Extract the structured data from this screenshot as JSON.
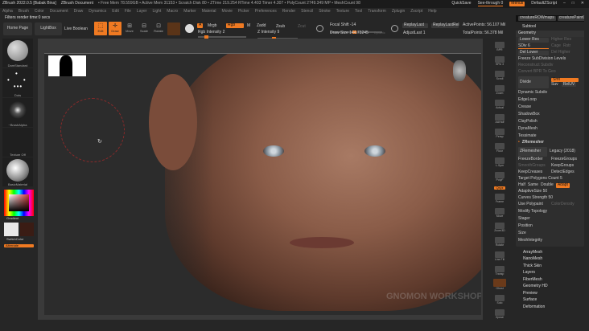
{
  "titlebar": {
    "app": "ZBrush 2022.0.5 [Babak Bina]",
    "doc": "ZBrush Document",
    "stats": "• Free Mem 78.559GB • Active Mem 31153 • Scratch Disk 80 • ZTime 219.254 RTime 4.403 Timer 4.307 • PolyCount 2749.349 MP • MeshCount 98",
    "quicksave": "QuickSave",
    "seethrough": "See-through 0",
    "menus": "Menus",
    "script": "DefaultZScript"
  },
  "menu": [
    "Alpha",
    "Brush",
    "Color",
    "Document",
    "Draw",
    "Dynamics",
    "Edit",
    "File",
    "Layer",
    "Light",
    "Macro",
    "Marker",
    "Material",
    "Movie",
    "Picker",
    "Preferences",
    "Render",
    "Stencil",
    "Stroke",
    "Texture",
    "Tool",
    "Transform",
    "Zplugin",
    "Zscript",
    "Help"
  ],
  "filters": "Filters render time:0 secs",
  "shelf": {
    "home": "Home Page",
    "lightbox": "LightBox",
    "live_boolean": "Live Boolean",
    "tools": [
      "Edit",
      "Draw",
      "Move",
      "Scale",
      "Rotate"
    ],
    "a": "A",
    "mrgb": "Mrgb",
    "rgb": "Rgb",
    "m": "M",
    "zadd": "Zadd",
    "zsub": "Zsub",
    "zcut": "Zcut",
    "rgb_intensity": "Rgb Intensity 2",
    "z_intensity": "Z Intensity 9",
    "focal_shift": "Focal Shift -14",
    "draw_size": "Draw Size 144.73245",
    "dynamic": "Dynamic",
    "replay_last": "ReplayLast",
    "replay_last_rel": "ReplayLastRel",
    "adjust_last": "AdjustLast 1",
    "active_points": "ActivePoints: 56.107 Mil",
    "total_points": "TotalPoints: 56.378 Mil"
  },
  "left": {
    "brush": "DamStandard",
    "stroke": "Dots",
    "alpha": "~BrushAlpha",
    "texture": "Texture Off",
    "material": "BasicMaterial",
    "gradient": "Gradient",
    "switch": "SwitchColor",
    "alternate": "Alternate",
    "main_color": "#e8e8e8",
    "secondary_color": "#3a1c14"
  },
  "rtool": [
    "BPR",
    "SPix 3",
    "Scroll",
    "Zoom",
    "Actual",
    "AAHalf",
    "Persp",
    "Floor",
    "L.Sym",
    "PolyF",
    "Qxyz",
    "Frame",
    "Move",
    "Zoom3D",
    "Rotate",
    "Line Fill",
    "Transp",
    "Ghost",
    "Solo",
    "Xpose"
  ],
  "rpanel": {
    "tool_names": [
      "creatureROWmaps",
      "creaturePaint03"
    ],
    "subtool": "Subtool",
    "geometry": "Geometry",
    "lower_res": "Lower Res",
    "higher_res": "Higher Res",
    "sdiv": "SDiv 6",
    "cage": "Cage",
    "rstr": "Rstr",
    "del_lower": "Del Lower",
    "del_higher": "Del Higher",
    "freeze_sub": "Freeze SubDivision Levels",
    "reconstruct": "Reconstruct Subdiv",
    "convert_bpr": "Convert BPR To Geo",
    "divide": "Divide",
    "smt": "Smt",
    "suv": "Suv",
    "reluv": "RelUV",
    "items1": [
      "Dynamic Subdiv",
      "EdgeLoop",
      "Crease",
      "ShadowBox",
      "ClayPolish",
      "DynaMesh",
      "Tessimate"
    ],
    "zremesher": "ZRemesher",
    "zremesher_btn": "ZRemesher",
    "legacy": "Legacy (2018)",
    "freeze_border": "FreezeBorder",
    "freeze_groups": "FreezeGroups",
    "smooth_groups": "SmoothGroups",
    "keep_groups": "KeepGroups",
    "keep_creases": "KeepCreases",
    "detect_edges": "DetectEdges",
    "target": "Target Polygons Count 5",
    "half": "Half",
    "same": "Same",
    "double": "Double",
    "adapt": "Adapt",
    "adaptive": "AdaptiveSize 50",
    "curves": "Curves Strength 50",
    "use_polypaint": "Use Polypaint",
    "color_density": "ColorDensity",
    "items2": [
      "Modify Topology",
      "Stager",
      "Position",
      "Size",
      "MeshIntegrity"
    ],
    "items3": [
      "ArrayMesh",
      "NanoMesh",
      "Thick Skin",
      "Layers",
      "FiberMesh",
      "Geometry HD",
      "Preview",
      "Surface",
      "Deformation"
    ]
  },
  "watermark": "GNOMON WORKSHOP",
  "accent": "#f07a22"
}
